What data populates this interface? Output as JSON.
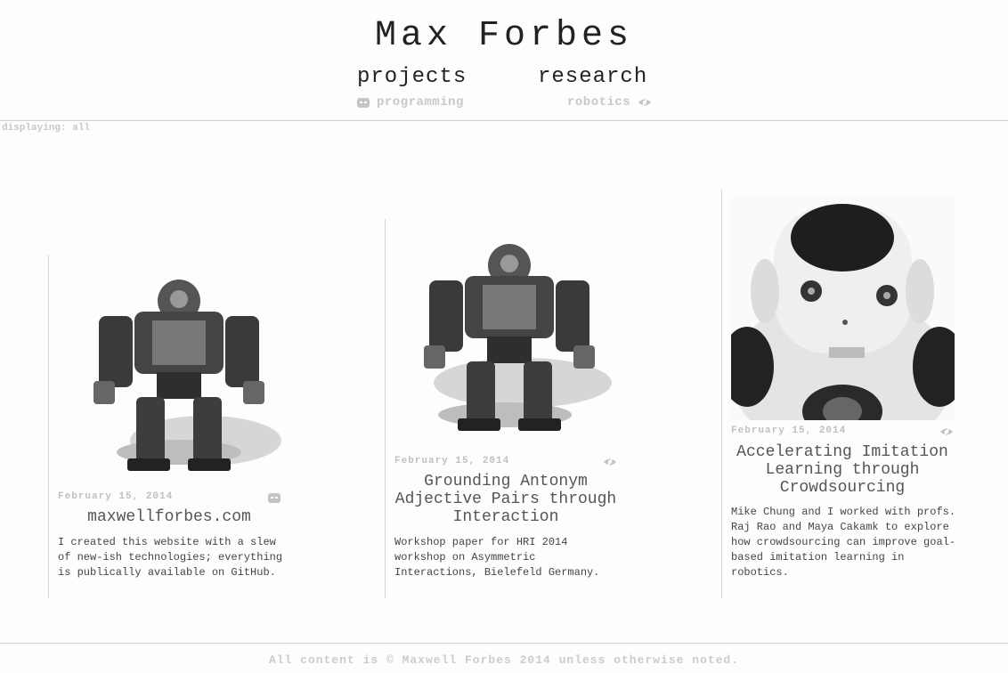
{
  "site": {
    "title": "Max Forbes"
  },
  "nav": {
    "projects_label": "projects",
    "research_label": "research",
    "programming_label": "programming",
    "robotics_label": "robotics"
  },
  "filter": {
    "status": "displaying: all"
  },
  "icons": {
    "programming": "robot-face-icon",
    "robotics": "eye-icon"
  },
  "cards": [
    {
      "date": "February 15, 2014",
      "tag_icon": "robot-face-icon",
      "title": "maxwellforbes.com",
      "description": "I created this website with a slew of new-ish technologies; everything is publically available on GitHub."
    },
    {
      "date": "February 15, 2014",
      "tag_icon": "eye-icon",
      "title": "Grounding Antonym Adjective Pairs through Interaction",
      "description": "Workshop paper for HRI 2014 workshop on Asymmetric Interactions, Bielefeld Germany."
    },
    {
      "date": "February 15, 2014",
      "tag_icon": "eye-icon",
      "title": "Accelerating Imitation Learning through Crowdsourcing",
      "description": "Mike Chung and I worked with profs. Raj Rao and Maya Cakamk to explore how crowdsourcing can improve goal-based imitation learning in robotics."
    }
  ],
  "footer": {
    "text": "All content is © Maxwell Forbes 2014 unless otherwise noted."
  }
}
